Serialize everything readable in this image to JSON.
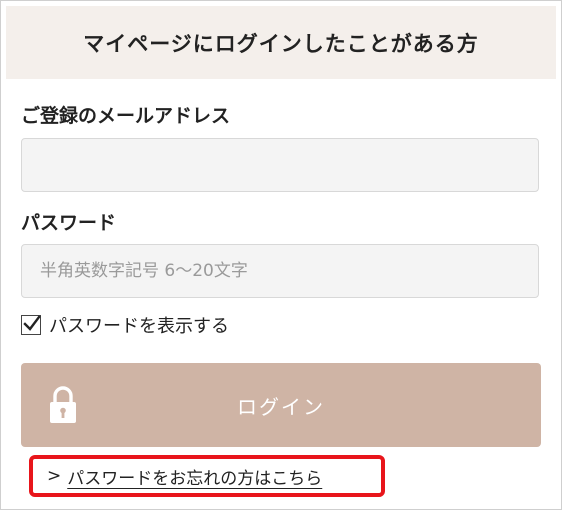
{
  "header": {
    "title": "マイページにログインしたことがある方"
  },
  "email": {
    "label": "ご登録のメールアドレス",
    "value": "",
    "placeholder": ""
  },
  "password": {
    "label": "パスワード",
    "value": "",
    "placeholder": "半角英数字記号 6〜20文字"
  },
  "show_password": {
    "label": "パスワードを表示する",
    "checked": true
  },
  "login_button": {
    "label": "ログイン",
    "icon": "lock-icon",
    "color": "#cfb4a5"
  },
  "forgot_password": {
    "arrow": ">",
    "label": "パスワードをお忘れの方はこちら",
    "highlight_color": "#e8151b"
  },
  "colors": {
    "header_bg": "#f4efeb",
    "field_bg": "#f4f4f4"
  }
}
